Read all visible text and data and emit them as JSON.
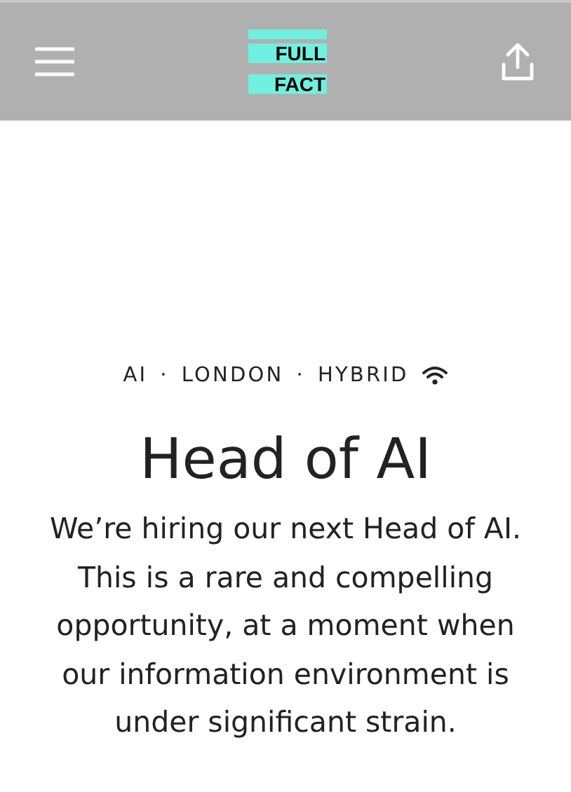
{
  "header": {
    "logo": [
      "FULL",
      "FACT"
    ]
  },
  "job": {
    "tags": [
      "AI",
      "LONDON",
      "HYBRID"
    ],
    "separator": "·",
    "title": "Head of AI",
    "intro": "We’re hiring our next Head of AI. This is a rare and compelling opportunity, at a moment when our information environment is under significant strain."
  }
}
